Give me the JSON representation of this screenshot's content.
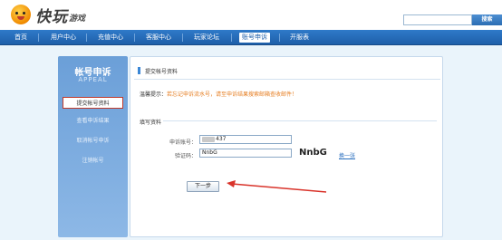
{
  "logo": {
    "text": "快玩",
    "sub": "游戏"
  },
  "search": {
    "placeholder": "",
    "button_label": "搜索"
  },
  "nav": {
    "items": [
      "首页",
      "用户中心",
      "充值中心",
      "客服中心",
      "玩家论坛",
      "账号申诉",
      "开服表"
    ],
    "active_index": 5
  },
  "sidebar": {
    "title": "帐号申诉",
    "subtitle": "APPEAL",
    "items": [
      "提交帐号资料",
      "查看申诉结果",
      "取消帐号申诉",
      "注销帐号"
    ],
    "active_index": 0
  },
  "main": {
    "tab_label": "提交帐号资料",
    "tip_label": "温馨提示：",
    "tip_text": "若忘记申诉流水号，请至申诉结果搜索邮箱查收邮件！",
    "section_title": "填写资料",
    "account_label": "申诉账号：",
    "account_value_suffix": "437",
    "captcha_label": "验证码：",
    "captcha_input_value": "NnbG",
    "captcha_image_text": "NnbG",
    "change_link": "换一张",
    "next_button": "下一步"
  },
  "colors": {
    "nav_bg": "#2f7ac9",
    "sidebar_bg": "#6b9fd8",
    "tip_text": "#e67e22",
    "annotation": "#d9342b"
  },
  "icons": {
    "logo": "mascot-face-icon",
    "tab_marker": "blue-bar-icon"
  }
}
